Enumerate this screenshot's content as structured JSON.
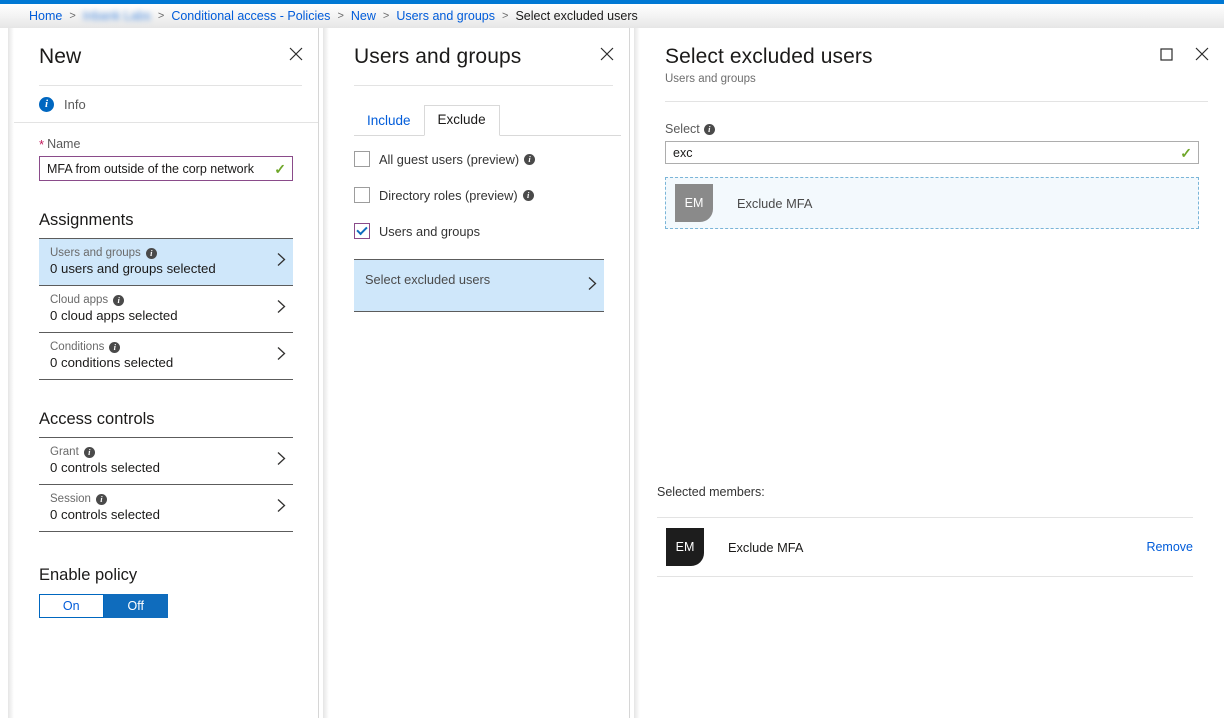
{
  "breadcrumb": {
    "items": [
      {
        "label": "Home",
        "type": "link"
      },
      {
        "label": "Inbank Labs",
        "type": "redacted"
      },
      {
        "label": "Conditional access - Policies",
        "type": "link"
      },
      {
        "label": "New",
        "type": "link"
      },
      {
        "label": "Users and groups",
        "type": "link"
      },
      {
        "label": "Select excluded users",
        "type": "current"
      }
    ],
    "separator": ">"
  },
  "colors": {
    "accent_blue": "#0078d4",
    "link_blue": "#015cda",
    "selected_row_blue": "#cfe7fa",
    "input_border_purple": "#8a4b8a",
    "valid_green": "#6fa72a",
    "toggle_on_blue": "#0f6cbd",
    "avatar_gray": "#8a8a8a",
    "avatar_dark": "#1d1d1d"
  },
  "blade_new": {
    "title": "New",
    "close_icon": "close-icon",
    "info": {
      "icon": "info-circle-icon",
      "label": "Info"
    },
    "name_field": {
      "required_marker": "*",
      "label": "Name",
      "value": "MFA from outside of the corp network",
      "placeholder": "",
      "valid_icon": "checkmark-icon"
    },
    "assignments": {
      "heading": "Assignments",
      "rows": [
        {
          "title": "Users and groups",
          "info_icon": "info-icon",
          "subtitle": "0 users and groups selected",
          "selected": true
        },
        {
          "title": "Cloud apps",
          "info_icon": "info-icon",
          "subtitle": "0 cloud apps selected",
          "selected": false
        },
        {
          "title": "Conditions",
          "info_icon": "info-icon",
          "subtitle": "0 conditions selected",
          "selected": false
        }
      ]
    },
    "access_controls": {
      "heading": "Access controls",
      "rows": [
        {
          "title": "Grant",
          "info_icon": "info-icon",
          "subtitle": "0 controls selected",
          "selected": false
        },
        {
          "title": "Session",
          "info_icon": "info-icon",
          "subtitle": "0 controls selected",
          "selected": false
        }
      ]
    },
    "enable_policy": {
      "heading": "Enable policy",
      "option_on": "On",
      "option_off": "Off",
      "selected": "Off"
    }
  },
  "blade_users": {
    "title": "Users and groups",
    "close_icon": "close-icon",
    "tabs": [
      {
        "label": "Include",
        "active": false
      },
      {
        "label": "Exclude",
        "active": true
      }
    ],
    "checkboxes": [
      {
        "label": "All guest users (preview)",
        "checked": false,
        "info_icon": "info-icon"
      },
      {
        "label": "Directory roles (preview)",
        "checked": false,
        "info_icon": "info-icon"
      },
      {
        "label": "Users and groups",
        "checked": true,
        "info_icon": ""
      }
    ],
    "select_row": {
      "label": "Select excluded users",
      "chevron_icon": "chevron-right-icon"
    }
  },
  "blade_select": {
    "title": "Select excluded users",
    "subtitle": "Users and groups",
    "maximize_icon": "maximize-icon",
    "close_icon": "close-icon",
    "select_field": {
      "label": "Select",
      "info_icon": "info-icon",
      "value": "exc",
      "placeholder": "",
      "valid_icon": "checkmark-icon"
    },
    "result": {
      "initials": "EM",
      "name": "Exclude MFA"
    },
    "selected_members_label": "Selected members:",
    "selected_members": [
      {
        "initials": "EM",
        "name": "Exclude MFA",
        "remove_label": "Remove"
      }
    ]
  }
}
